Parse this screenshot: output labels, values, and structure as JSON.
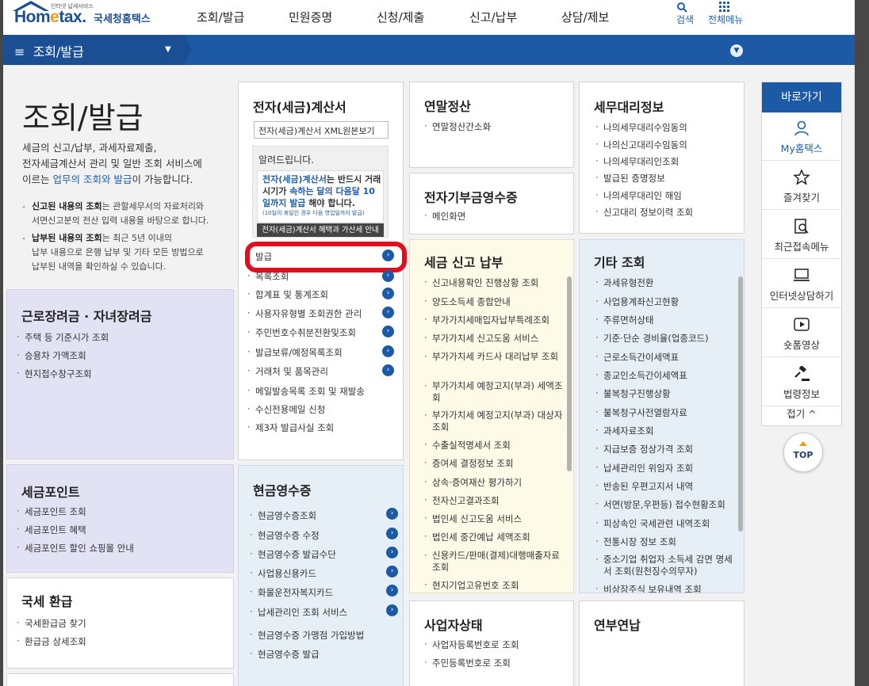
{
  "header": {
    "logo_small": "인터넷 납세서비스",
    "logo_main_a": "Hom",
    "logo_main_e": "e",
    "logo_main_b": "tax.",
    "logo_kr": "국세청홈택스",
    "nav": [
      "조회/발급",
      "민원증명",
      "신청/제출",
      "신고/납부",
      "상담/제보"
    ],
    "search_label": "검색",
    "all_menu_label": "전체메뉴"
  },
  "location": {
    "menu_label": "조회/발급"
  },
  "intro": {
    "title": "조회/발급",
    "desc_a": "세금의 신고/납부, 과세자료제출,",
    "desc_b": "전자세금계산서 관리 및 일반 조회 서비스에",
    "desc_c1": "이르는 ",
    "desc_c2": "업무의 조회와 발급",
    "desc_c3": "이 가능합니다.",
    "note1_bold": "신고된 내용의 조회",
    "note1_rest": "는 관할세무서의 자료처리와",
    "note1_line2": "서면신고분의 전산 입력 내용을 바탕으로 합니다.",
    "note2_bold": "납부된 내용의 조회",
    "note2_rest": "는 최근 5년 이내의",
    "note2_line2": "납부 내용으로 은행 납부 및 기타 모든 방법으로",
    "note2_line3": "납부된 내역을 확인하실 수 있습니다."
  },
  "boxes": {
    "labor": {
      "title": "근로장려금 · 자녀장려금",
      "items": [
        "주택 등 기준시가 조회",
        "승용차 가액조회",
        "현지접수창구조회"
      ]
    },
    "point": {
      "title": "세금포인트",
      "items": [
        "세금포인트 조회",
        "세금포인트 혜택",
        "세금포인트 할인 쇼핑몰 안내"
      ]
    },
    "refund": {
      "title": "국세 환급",
      "items": [
        "국세환급금 찾기",
        "환급금 상세조회"
      ]
    },
    "einvoice": {
      "title": "전자(세금)계산서",
      "select": "전자(세금)계산서 XML원본보기",
      "notice_title": "알려드립니다.",
      "notice_b1": "전자(세금)계산서",
      "notice_t1": "는 반드시 거래시기가 ",
      "notice_b2": "속하는 달의 다음달 10일까지 발급",
      "notice_t2": " 해야 합니다.",
      "notice_small": "(10일이 휴일인 경우 다음 영업일까지 발급)",
      "notice_btn": "전자(세금)계산서 혜택과 가산세 안내",
      "items": [
        "발급",
        "목록조회",
        "합계표 및 통계조회",
        "사용자유형별 조회권한 관리",
        "주민번호수취분전환및조회",
        "발급보류/예정목록조회",
        "거래처 및 품목관리",
        "메일발송목록 조회 및 재발송",
        "수신전용메일 신청",
        "제3자 발급사실 조회"
      ]
    },
    "cash": {
      "title": "현금영수증",
      "items": [
        "현금영수증조회",
        "현금영수증 수정",
        "현금영수증 발급수단",
        "사업용신용카드",
        "화물운전자복지카드",
        "납세관리인 조회 서비스",
        "현금영수증 가맹점 가입방법",
        "현금영수증 발급"
      ]
    },
    "yearend": {
      "title": "연말정산",
      "items": [
        "연말정산간소화"
      ]
    },
    "donation": {
      "title": "전자기부금영수증",
      "items": [
        "메인화면"
      ]
    },
    "taxreport": {
      "title": "세금 신고 납부",
      "items": [
        "신고내용확인 진행상황 조회",
        "양도소득세 종합안내",
        "부가가치세매입자납부특례조회",
        "부가가치세 신고도움 서비스",
        "부가가치세 카드사 대리납부 조회",
        "부가가치세 예정고지(부과) 세액조회",
        "부가가치세 예정고지(부과) 대상자 조회",
        "수출실적명세서 조회",
        "증여세 결정정보 조회",
        "상속·증여재산 평가하기",
        "전자신고결과조회",
        "법인세 신고도움 서비스",
        "법인세 중간예납 세액조회",
        "신용카드/판매(결제)대행매출자료조회",
        "현지기업고유번호 조회"
      ]
    },
    "business": {
      "title": "사업자상태",
      "items": [
        "사업자등록번호로 조회",
        "주민등록번호로 조회"
      ]
    },
    "agent": {
      "title": "세무대리정보",
      "items": [
        "나의세무대리수임동의",
        "나의신고대리수임동의",
        "나의세무대리인조회",
        "발급된 증명정보",
        "나의세무대리인 해임",
        "신고대리 정보이력 조회"
      ]
    },
    "others": {
      "title": "기타 조회",
      "items": [
        "과세유형전환",
        "사업용계좌신고현황",
        "주류면허상태",
        "기준·단순 경비율(업종코드)",
        "근로소득간이세액표",
        "종교인소득간이세액표",
        "불복청구진행상황",
        "불복청구사전열람자료",
        "과세자료조회",
        "지급보증 정상가격 조회",
        "납세관리인 위임자 조회",
        "반송된 우편고지서 내역",
        "서면(방문,우편등) 접수현황조회",
        "피상속인 국세관련 내역조회",
        "전통시장 정보 조회",
        "중소기업 취업자 소득세 감면 명세서 조회(원천징수의무자)",
        "비상장주식 보유내역 조회"
      ]
    },
    "pension": {
      "title": "연부연납"
    }
  },
  "quick": {
    "title": "바로가기",
    "items": [
      "My홈택스",
      "즐겨찾기",
      "최근접속메뉴",
      "인터넷상담하기",
      "숏폼영상",
      "법령정보"
    ],
    "close": "접기",
    "top": "TOP"
  }
}
